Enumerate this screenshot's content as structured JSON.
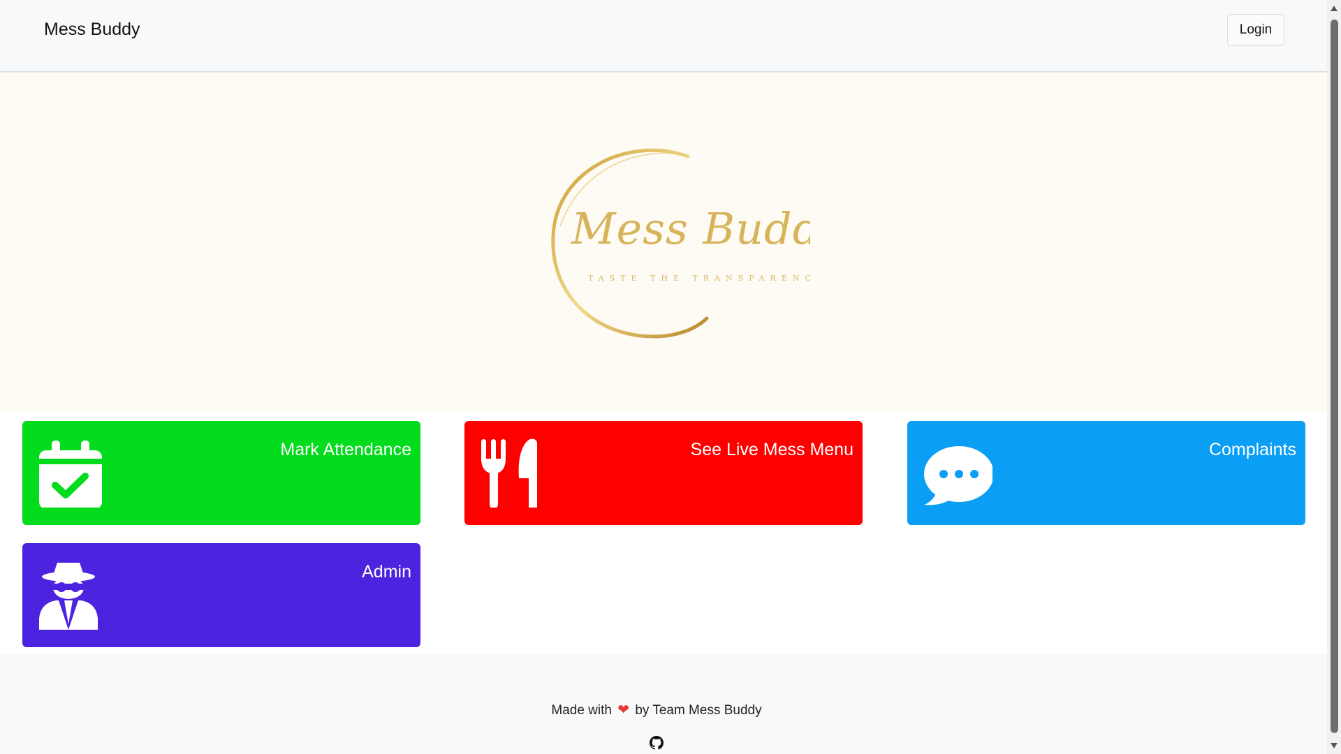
{
  "navbar": {
    "brand": "Mess Buddy",
    "login_label": "Login"
  },
  "hero": {
    "logo_text": "Mess Buddy",
    "logo_tagline": "TASTE THE TRANSPARENCY."
  },
  "cards": [
    {
      "title": "Mark Attendance",
      "icon": "calendar-check-icon",
      "color": "#03dc1c"
    },
    {
      "title": "See Live Mess Menu",
      "icon": "utensils-icon",
      "color": "#ff0000"
    },
    {
      "title": "Complaints",
      "icon": "chat-bubble-icon",
      "color": "#0a9ef5"
    },
    {
      "title": "Admin",
      "icon": "user-secret-icon",
      "color": "#4c24e0"
    }
  ],
  "footer": {
    "made_with": "Made with",
    "by_team": "by Team Mess Buddy",
    "heart_icon": "heart-icon",
    "github_icon": "github-icon"
  },
  "colors": {
    "navbar_bg": "#f8f9fa",
    "hero_bg": "#fefbf5",
    "logo_gold": "#d4b25c"
  }
}
